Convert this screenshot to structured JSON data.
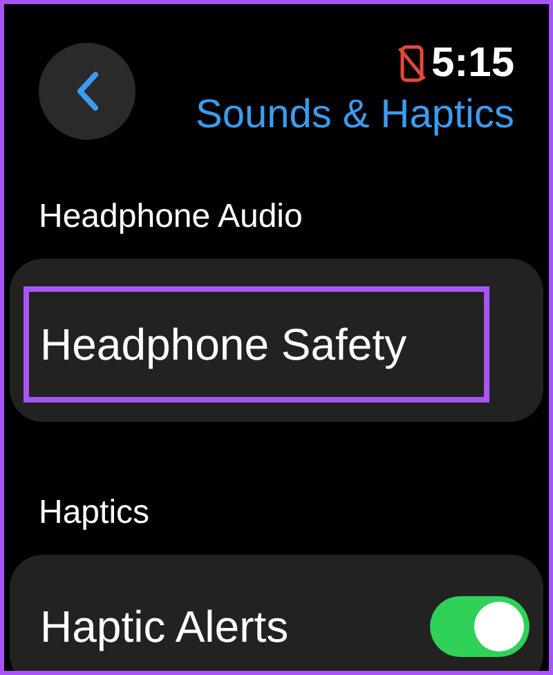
{
  "header": {
    "time": "5:15",
    "phone_disconnected": true,
    "title": "Sounds & Haptics"
  },
  "sections": [
    {
      "heading": "Headphone Audio",
      "rows": [
        {
          "kind": "link",
          "label": "Headphone Safety",
          "highlighted": true
        }
      ]
    },
    {
      "heading": "Haptics",
      "rows": [
        {
          "kind": "toggle",
          "label": "Haptic Alerts",
          "on": true
        }
      ]
    }
  ]
}
